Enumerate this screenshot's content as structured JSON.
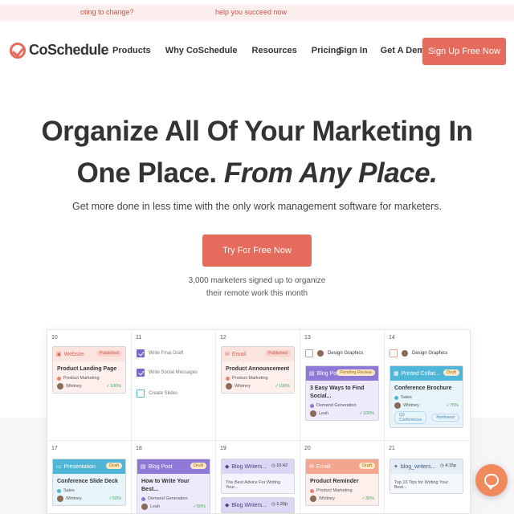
{
  "promo": {
    "left_text": "oting to change?",
    "right_text": "help you succeed now"
  },
  "header": {
    "logo_text": "CoSchedule",
    "nav": [
      "Products",
      "Why CoSchedule",
      "Resources",
      "Pricing"
    ],
    "sign_in": "Sign In",
    "get_demo": "Get A Demo",
    "sign_up": "Sign Up Free Now"
  },
  "hero": {
    "title_line1": "Organize All Of Your Marketing In",
    "title_line2_plain": "One Place. ",
    "title_line2_italic": "From Any Place.",
    "subtitle": "Get more done in less time with the only work management software for marketers.",
    "cta": "Try For Free Now",
    "note": "3,000 marketers signed up to organize their remote work this month"
  },
  "calendar": {
    "days": [
      "10",
      "11",
      "12",
      "13",
      "14",
      "17",
      "18",
      "19",
      "20",
      "21"
    ],
    "colors": {
      "website": "#e8826f",
      "email": "#e8826f",
      "blog": "#8e7ad6",
      "print": "#4fb6d8",
      "presentation": "#4fb6d8",
      "social": "#6c86c9"
    },
    "d10": {
      "type": "Website",
      "tag": "Published",
      "title": "Product Landing Page",
      "meta": "Product Marketing",
      "user": "Whitney",
      "pct": "✓100%"
    },
    "d11": {
      "items": [
        "Write Final Draft",
        "Write Social Messages",
        "Create Slides"
      ]
    },
    "d12": {
      "type": "Email",
      "tag": "Published",
      "title": "Product Announcement",
      "meta": "Product Marketing",
      "user": "Whitney",
      "pct": "✓100%"
    },
    "d13": {
      "mini": "Design Graphics",
      "type": "Blog Post",
      "tag": "Pending Review",
      "title": "3 Easy Ways to Find Social...",
      "meta": "Demand Generation",
      "user": "Leah",
      "pct": "✓100%"
    },
    "d14": {
      "mini": "Design Graphics",
      "type": "Printed Collat...",
      "tag": "Draft",
      "title": "Conference Brochure",
      "meta": "Sales",
      "user": "Whitney",
      "pct": "✓75%",
      "chips": [
        "Q3 Conferences",
        "Northwest"
      ]
    },
    "d17": {
      "type": "Presentation",
      "tag": "Draft",
      "title": "Conference Slide Deck",
      "meta": "Sales",
      "user": "Whitney",
      "pct": "✓50%"
    },
    "d18": {
      "type": "Blog Post",
      "tag": "Draft",
      "title": "How to Write Your Best...",
      "meta": "Demand Generation",
      "user": "Leah",
      "pct": "✓50%"
    },
    "d19": {
      "type": "Blog Writers...",
      "time": "10:42",
      "title": "The Best Advice For Writing Your...",
      "type2": "Blog Writers...",
      "time2": "1:20p"
    },
    "d20": {
      "type": "Email",
      "tag": "Draft",
      "title": "Product Reminder",
      "meta": "Product Marketing",
      "user": "Whitney",
      "pct": "✓30%"
    },
    "d21": {
      "type": "blog_writers...",
      "time": "4:15p",
      "title": "Top 10 Tips for Writing Your Best..."
    }
  }
}
